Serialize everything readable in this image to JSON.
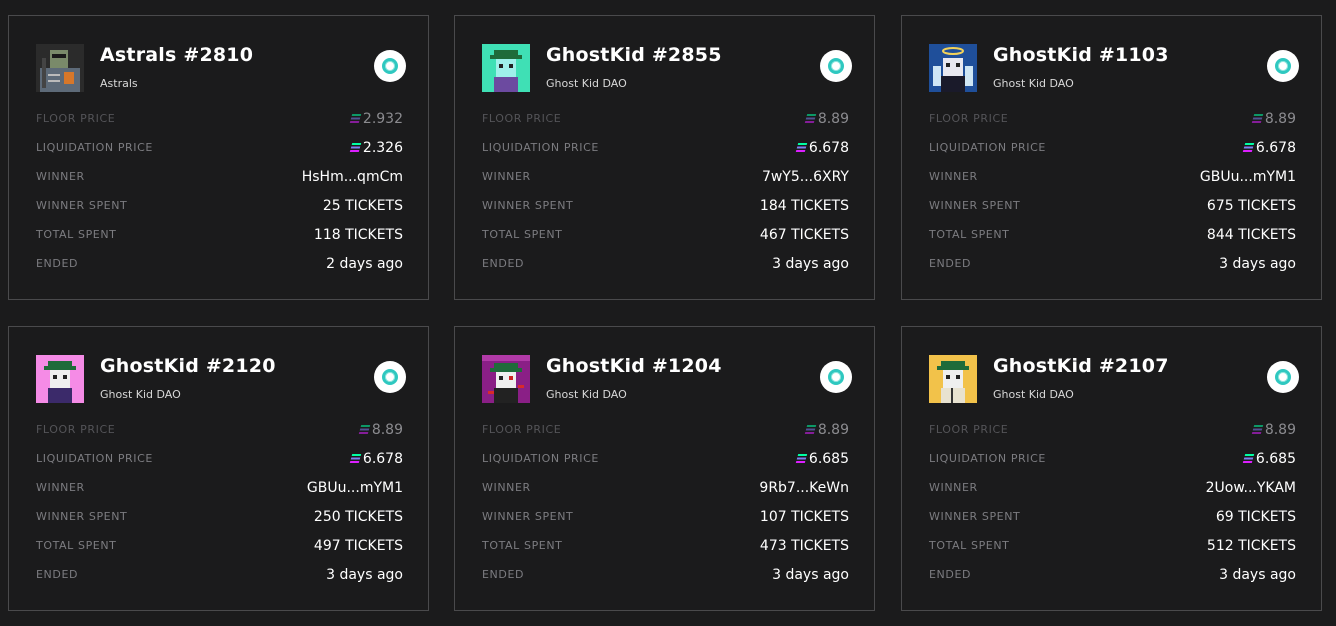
{
  "labels": {
    "floor_price": "FLOOR PRICE",
    "liquidation_price": "LIQUIDATION PRICE",
    "winner": "WINNER",
    "winner_spent": "WINNER SPENT",
    "total_spent": "TOTAL SPENT",
    "ended": "ENDED"
  },
  "currency_icon": "solana-icon",
  "platform_icon": "platform-badge-icon",
  "colors": {
    "background": "#1b1b1c",
    "card_border": "#4a4a4c",
    "label": "#7c7c80",
    "badge_accent": "#2fc8c0"
  },
  "cards": [
    {
      "title": "Astrals #2810",
      "collection": "Astrals",
      "thumb_bg": "#2b2b2b",
      "floor_price": "2.932",
      "liquidation_price": "2.326",
      "winner": "HsHm...qmCm",
      "winner_spent": "25 TICKETS",
      "total_spent": "118 TICKETS",
      "ended": "2 days ago"
    },
    {
      "title": "GhostKid #2855",
      "collection": "Ghost Kid DAO",
      "thumb_bg": "#3fe0b5",
      "floor_price": "8.89",
      "liquidation_price": "6.678",
      "winner": "7wY5...6XRY",
      "winner_spent": "184 TICKETS",
      "total_spent": "467 TICKETS",
      "ended": "3 days ago"
    },
    {
      "title": "GhostKid #1103",
      "collection": "Ghost Kid DAO",
      "thumb_bg": "#1f4f9a",
      "floor_price": "8.89",
      "liquidation_price": "6.678",
      "winner": "GBUu...mYM1",
      "winner_spent": "675 TICKETS",
      "total_spent": "844 TICKETS",
      "ended": "3 days ago"
    },
    {
      "title": "GhostKid #2120",
      "collection": "Ghost Kid DAO",
      "thumb_bg": "#f58be6",
      "floor_price": "8.89",
      "liquidation_price": "6.678",
      "winner": "GBUu...mYM1",
      "winner_spent": "250 TICKETS",
      "total_spent": "497 TICKETS",
      "ended": "3 days ago"
    },
    {
      "title": "GhostKid #1204",
      "collection": "Ghost Kid DAO",
      "thumb_bg": "#8a1f86",
      "floor_price": "8.89",
      "liquidation_price": "6.685",
      "winner": "9Rb7...KeWn",
      "winner_spent": "107 TICKETS",
      "total_spent": "473 TICKETS",
      "ended": "3 days ago"
    },
    {
      "title": "GhostKid #2107",
      "collection": "Ghost Kid DAO",
      "thumb_bg": "#f2c24a",
      "floor_price": "8.89",
      "liquidation_price": "6.685",
      "winner": "2Uow...YKAM",
      "winner_spent": "69 TICKETS",
      "total_spent": "512 TICKETS",
      "ended": "3 days ago"
    }
  ]
}
